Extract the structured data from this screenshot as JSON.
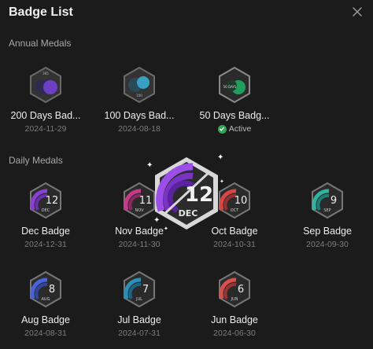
{
  "window": {
    "title": "Badge List"
  },
  "annual": {
    "label": "Annual Medals",
    "items": [
      {
        "name": "200 Days Bad...",
        "date": "2024-11-29",
        "days": "365"
      },
      {
        "name": "100 Days Bad...",
        "date": "2024-08-18",
        "days": "100"
      },
      {
        "name": "50 Days Badg...",
        "status": "Active",
        "days": "50 DAYS"
      }
    ]
  },
  "daily": {
    "label": "Daily Medals",
    "items": [
      {
        "name": "Dec Badge",
        "date": "2024-12-31",
        "num": "12",
        "month": "DEC",
        "color": "#8a3fd6"
      },
      {
        "name": "Nov Badge",
        "date": "2024-11-30",
        "num": "11",
        "month": "NOV",
        "color": "#c73a8a"
      },
      {
        "name": "Oct Badge",
        "date": "2024-10-31",
        "num": "10",
        "month": "OCT",
        "color": "#d94545"
      },
      {
        "name": "Sep Badge",
        "date": "2024-09-30",
        "num": "9",
        "month": "SEP",
        "color": "#2fb3a3"
      },
      {
        "name": "Aug Badge",
        "date": "2024-08-31",
        "num": "8",
        "month": "AUG",
        "color": "#4a64d8"
      },
      {
        "name": "Jul Badge",
        "date": "2024-07-31",
        "num": "7",
        "month": "JUL",
        "color": "#2a8fb8"
      },
      {
        "name": "Jun Badge",
        "date": "2024-06-30",
        "num": "6",
        "month": "JUN",
        "color": "#d8504d"
      }
    ]
  },
  "featured": {
    "num": "12",
    "month": "DEC",
    "color": "#8a3fd6"
  }
}
